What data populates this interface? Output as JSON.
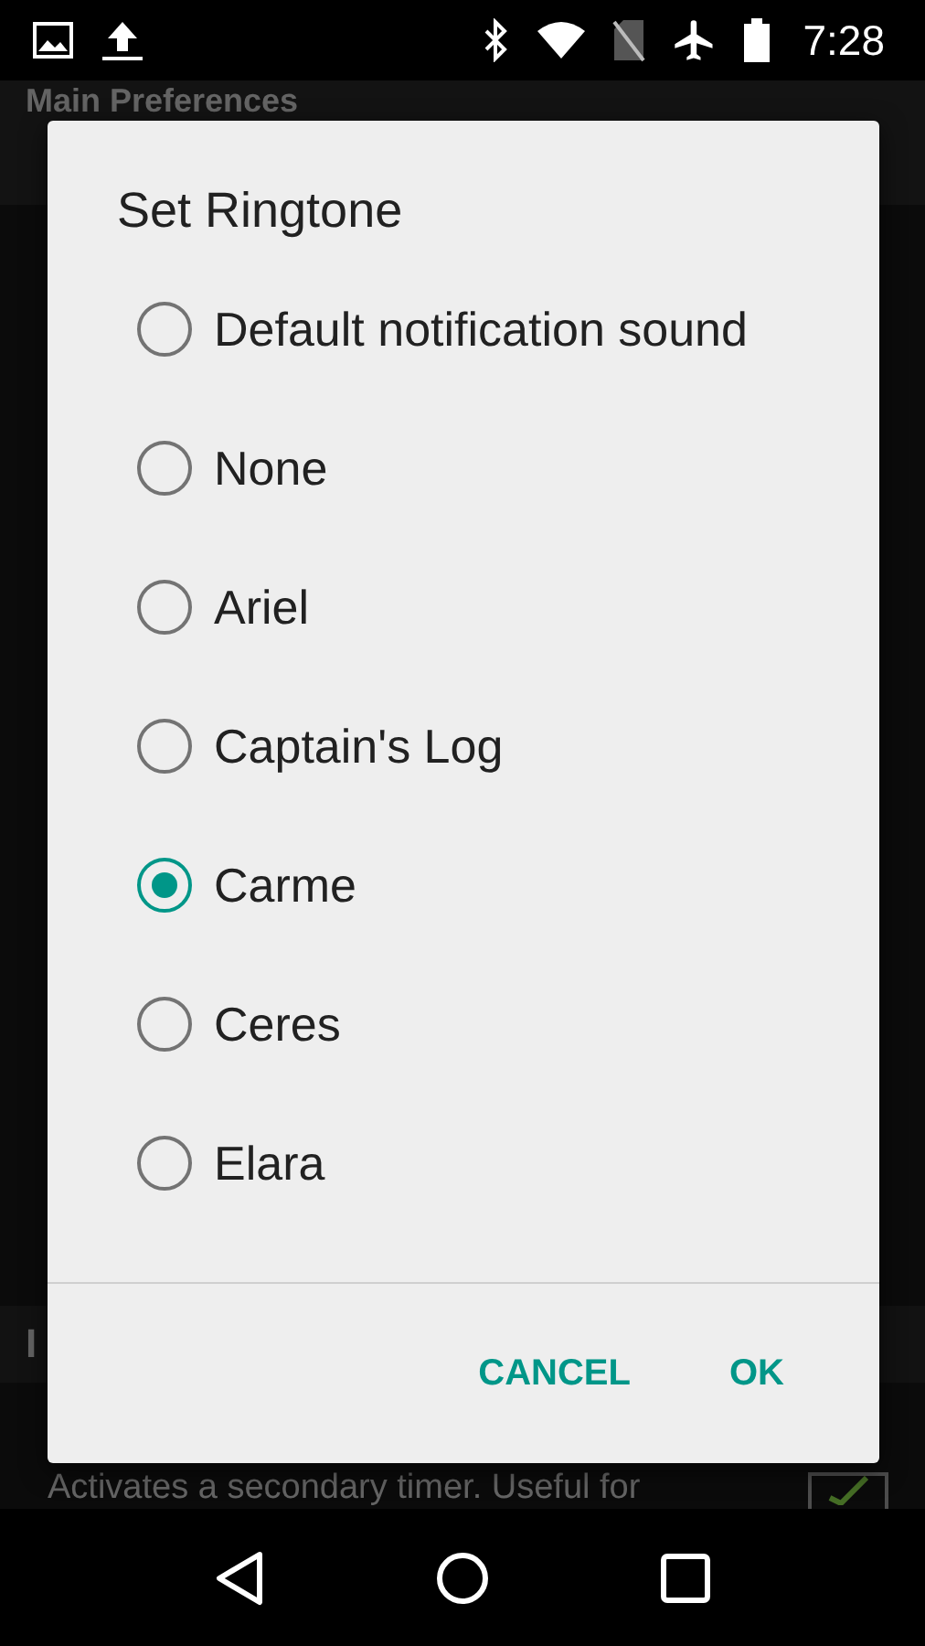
{
  "status_bar": {
    "time": "7:28"
  },
  "background": {
    "header": "Main Preferences",
    "section_label": "I",
    "description": "Activates a secondary timer. Useful for",
    "checkbox_checked": true
  },
  "dialog": {
    "title": "Set Ringtone",
    "options": [
      {
        "label": "Default notification sound",
        "selected": false
      },
      {
        "label": "None",
        "selected": false
      },
      {
        "label": "Ariel",
        "selected": false
      },
      {
        "label": "Captain's Log",
        "selected": false
      },
      {
        "label": "Carme",
        "selected": true
      },
      {
        "label": "Ceres",
        "selected": false
      },
      {
        "label": "Elara",
        "selected": false
      }
    ],
    "buttons": [
      "CANCEL",
      "OK"
    ]
  }
}
